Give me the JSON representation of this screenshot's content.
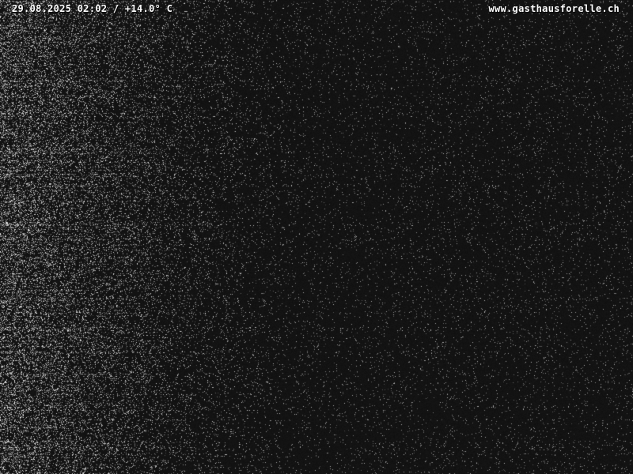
{
  "overlay": {
    "timestamp": "29.08.2025 02:02 / +14.0° C",
    "site_url": "www.gasthausforelle.ch"
  },
  "scene": {
    "description_kind": "night webcam frame, mostly dark with sensor noise",
    "base_color": "#121212",
    "noise_color": "#ffffff",
    "text_color": "#ffffff"
  }
}
